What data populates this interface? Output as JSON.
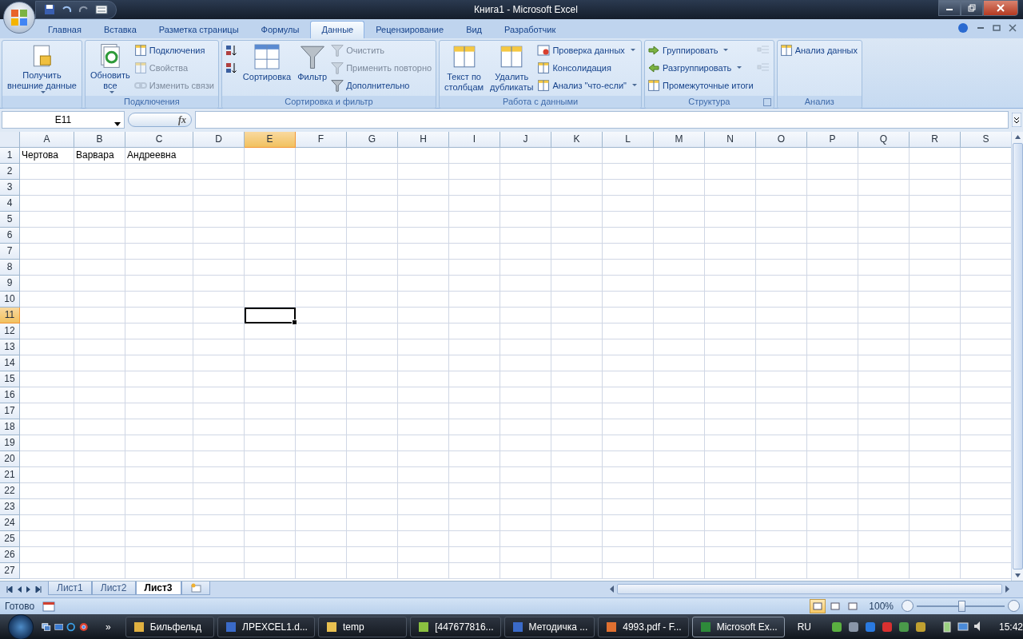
{
  "window": {
    "title": "Книга1 - Microsoft Excel"
  },
  "tabs": [
    {
      "label": "Главная",
      "selected": false
    },
    {
      "label": "Вставка",
      "selected": false
    },
    {
      "label": "Разметка страницы",
      "selected": false
    },
    {
      "label": "Формулы",
      "selected": false
    },
    {
      "label": "Данные",
      "selected": true
    },
    {
      "label": "Рецензирование",
      "selected": false
    },
    {
      "label": "Вид",
      "selected": false
    },
    {
      "label": "Разработчик",
      "selected": false
    }
  ],
  "ribbon": {
    "groups": [
      {
        "launcher": false,
        "columns": [
          {
            "kind": "large",
            "items": [
              {
                "label": "Получить\nвнешние данные",
                "disabled": false,
                "dropdown": true
              }
            ]
          }
        ]
      },
      {
        "label": "Подключения",
        "launcher": false,
        "columns": [
          {
            "kind": "large",
            "items": [
              {
                "label": "Обновить\nвсе",
                "disabled": false,
                "dropdown": true
              }
            ]
          },
          {
            "kind": "stack",
            "items": [
              {
                "label": "Подключения",
                "disabled": false,
                "dropdown": false
              },
              {
                "label": "Свойства",
                "disabled": true,
                "dropdown": false
              },
              {
                "label": "Изменить связи",
                "disabled": true,
                "dropdown": false
              }
            ]
          }
        ]
      },
      {
        "label": "Сортировка и фильтр",
        "launcher": false,
        "columns": [
          {
            "kind": "stack",
            "items": [
              {
                "disabled": false,
                "dropdown": false
              },
              {
                "disabled": false,
                "dropdown": false
              }
            ]
          },
          {
            "kind": "large",
            "items": [
              {
                "label": "Сортировка",
                "disabled": false,
                "dropdown": false
              }
            ]
          },
          {
            "kind": "large",
            "items": [
              {
                "label": "Фильтр",
                "disabled": false,
                "dropdown": false
              }
            ]
          },
          {
            "kind": "stack",
            "items": [
              {
                "label": "Очистить",
                "disabled": true,
                "dropdown": false
              },
              {
                "label": "Применить повторно",
                "disabled": true,
                "dropdown": false
              },
              {
                "label": "Дополнительно",
                "disabled": false,
                "dropdown": false
              }
            ]
          }
        ]
      },
      {
        "label": "Работа с данными",
        "launcher": false,
        "columns": [
          {
            "kind": "large",
            "items": [
              {
                "label": "Текст по\nстолбцам",
                "disabled": false,
                "dropdown": false
              },
              {
                "label": "Удалить\nдубликаты",
                "disabled": false,
                "dropdown": false
              }
            ]
          },
          {
            "kind": "stack",
            "items": [
              {
                "label": "Проверка данных",
                "disabled": false,
                "dropdown": true
              },
              {
                "label": "Консолидация",
                "disabled": false,
                "dropdown": false
              },
              {
                "label": "Анализ \"что-если\"",
                "disabled": false,
                "dropdown": true
              }
            ]
          }
        ]
      },
      {
        "label": "Структура",
        "launcher": true,
        "columns": [
          {
            "kind": "stack",
            "items": [
              {
                "label": "Группировать",
                "disabled": false,
                "dropdown": true
              },
              {
                "label": "Разгруппировать",
                "disabled": false,
                "dropdown": true
              },
              {
                "label": "Промежуточные итоги",
                "disabled": false,
                "dropdown": false
              }
            ]
          },
          {
            "kind": "stack",
            "items": [
              {
                "disabled": true,
                "dropdown": false
              },
              {
                "disabled": true,
                "dropdown": false
              }
            ]
          }
        ]
      },
      {
        "label": "Анализ",
        "launcher": false,
        "columns": [
          {
            "kind": "stack",
            "items": [
              {
                "label": "Анализ данных",
                "disabled": false,
                "dropdown": false
              }
            ]
          }
        ]
      }
    ]
  },
  "formula_bar": {
    "name_box": "E11",
    "function_label": "fx"
  },
  "columns": [
    {
      "label": "A",
      "selected": false
    },
    {
      "label": "B",
      "selected": false
    },
    {
      "label": "C",
      "selected": false
    },
    {
      "label": "D",
      "selected": false
    },
    {
      "label": "E",
      "selected": true
    },
    {
      "label": "F",
      "selected": false
    },
    {
      "label": "G",
      "selected": false
    },
    {
      "label": "H",
      "selected": false
    },
    {
      "label": "I",
      "selected": false
    },
    {
      "label": "J",
      "selected": false
    },
    {
      "label": "K",
      "selected": false
    },
    {
      "label": "L",
      "selected": false
    },
    {
      "label": "M",
      "selected": false
    },
    {
      "label": "N",
      "selected": false
    },
    {
      "label": "O",
      "selected": false
    },
    {
      "label": "P",
      "selected": false
    },
    {
      "label": "Q",
      "selected": false
    },
    {
      "label": "R",
      "selected": false
    },
    {
      "label": "S",
      "selected": false
    }
  ],
  "rows": [
    {
      "label": "1",
      "selected": false,
      "cells": [
        "Чертова",
        "Варвара",
        "Андреевна"
      ]
    },
    {
      "label": "2",
      "selected": false
    },
    {
      "label": "3",
      "selected": false
    },
    {
      "label": "4",
      "selected": false
    },
    {
      "label": "5",
      "selected": false
    },
    {
      "label": "6",
      "selected": false
    },
    {
      "label": "7",
      "selected": false
    },
    {
      "label": "8",
      "selected": false
    },
    {
      "label": "9",
      "selected": false
    },
    {
      "label": "10",
      "selected": false
    },
    {
      "label": "11",
      "selected": true
    },
    {
      "label": "12",
      "selected": false
    },
    {
      "label": "13",
      "selected": false
    },
    {
      "label": "14",
      "selected": false
    },
    {
      "label": "15",
      "selected": false
    },
    {
      "label": "16",
      "selected": false
    },
    {
      "label": "17",
      "selected": false
    },
    {
      "label": "18",
      "selected": false
    },
    {
      "label": "19",
      "selected": false
    },
    {
      "label": "20",
      "selected": false
    },
    {
      "label": "21",
      "selected": false
    },
    {
      "label": "22",
      "selected": false
    },
    {
      "label": "23",
      "selected": false
    },
    {
      "label": "24",
      "selected": false
    },
    {
      "label": "25",
      "selected": false
    },
    {
      "label": "26",
      "selected": false
    },
    {
      "label": "27",
      "selected": false
    }
  ],
  "sheet_tabs": [
    {
      "label": "Лист1",
      "selected": false
    },
    {
      "label": "Лист2",
      "selected": false
    },
    {
      "label": "Лист3",
      "selected": true
    }
  ],
  "status_bar": {
    "status": "Готово",
    "view_buttons": [
      {
        "selected": true
      },
      {
        "selected": false
      },
      {
        "selected": false
      }
    ],
    "zoom": "100%",
    "zoom_slider": {
      "level": 0.5
    }
  },
  "taskbar": {
    "overflow": "»",
    "items": [
      {
        "label": "Бильфельд",
        "selected": false
      },
      {
        "label": "ЛРEXCEL1.d...",
        "selected": false
      },
      {
        "label": "temp",
        "selected": false
      },
      {
        "label": "[447677816...",
        "selected": false
      },
      {
        "label": "Методичка ...",
        "selected": false
      },
      {
        "label": "4993.pdf - F...",
        "selected": false
      },
      {
        "label": "Microsoft Ex...",
        "selected": true
      }
    ],
    "language": "RU",
    "clock": "15:42"
  }
}
